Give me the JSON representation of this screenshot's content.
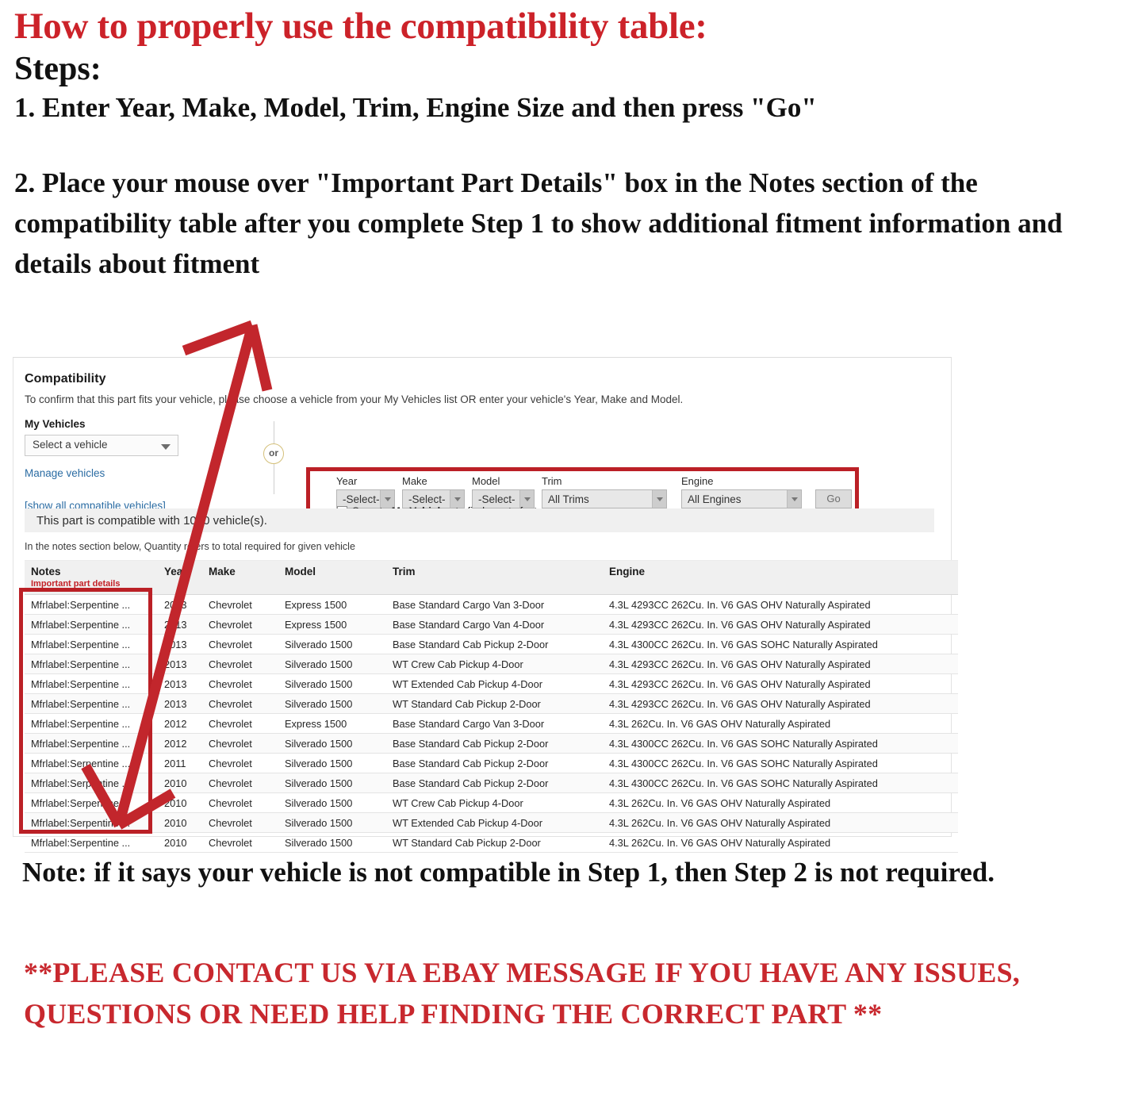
{
  "headline": {
    "title": "How to properly use the compatibility table:",
    "steps_label": "Steps:",
    "step1": "1. Enter Year, Make, Model, Trim, Engine Size and then press \"Go\"",
    "step2": "2. Place your mouse over \"Important Part Details\" box in the Notes section of the compatibility table after you complete Step 1 to show additional fitment information and details about fitment"
  },
  "panel": {
    "heading": "Compatibility",
    "subheading": "To confirm that this part fits your vehicle, please choose a vehicle from your My Vehicles list OR enter your vehicle's Year, Make and Model.",
    "my_vehicles_label": "My Vehicles",
    "vehicle_select_value": "Select a vehicle",
    "manage_vehicles_link": "Manage vehicles",
    "show_all_link": "[show all compatible vehicles]",
    "or_divider": "or",
    "selectors": [
      {
        "label": "Year",
        "value": "-Select-",
        "name": "year"
      },
      {
        "label": "Make",
        "value": "-Select-",
        "name": "make"
      },
      {
        "label": "Model",
        "value": "-Select-",
        "name": "model"
      },
      {
        "label": "Trim",
        "value": "All Trims",
        "name": "trim"
      },
      {
        "label": "Engine",
        "value": "All Engines",
        "name": "engine"
      }
    ],
    "go_button": "Go",
    "save_prefix": "Save to",
    "save_bold": "My Vehicles",
    "save_suffix": "to finds parts faster",
    "compat_count": "This part is compatible with 1000 vehicle(s).",
    "quantity_note": "In the notes section below, Quantity refers to total required for given vehicle"
  },
  "table": {
    "headers": {
      "notes": "Notes",
      "notes_sub": "Important part details",
      "year": "Year",
      "make": "Make",
      "model": "Model",
      "trim": "Trim",
      "engine": "Engine"
    },
    "rows": [
      {
        "notes": "Mfrlabel:Serpentine ...",
        "year": "2013",
        "make": "Chevrolet",
        "model": "Express 1500",
        "trim": "Base Standard Cargo Van 3-Door",
        "engine": "4.3L 4293CC 262Cu. In. V6 GAS OHV Naturally Aspirated"
      },
      {
        "notes": "Mfrlabel:Serpentine ...",
        "year": "2013",
        "make": "Chevrolet",
        "model": "Express 1500",
        "trim": "Base Standard Cargo Van 4-Door",
        "engine": "4.3L 4293CC 262Cu. In. V6 GAS OHV Naturally Aspirated"
      },
      {
        "notes": "Mfrlabel:Serpentine ...",
        "year": "2013",
        "make": "Chevrolet",
        "model": "Silverado 1500",
        "trim": "Base Standard Cab Pickup 2-Door",
        "engine": "4.3L 4300CC 262Cu. In. V6 GAS SOHC Naturally Aspirated"
      },
      {
        "notes": "Mfrlabel:Serpentine ...",
        "year": "2013",
        "make": "Chevrolet",
        "model": "Silverado 1500",
        "trim": "WT Crew Cab Pickup 4-Door",
        "engine": "4.3L 4293CC 262Cu. In. V6 GAS OHV Naturally Aspirated"
      },
      {
        "notes": "Mfrlabel:Serpentine ...",
        "year": "2013",
        "make": "Chevrolet",
        "model": "Silverado 1500",
        "trim": "WT Extended Cab Pickup 4-Door",
        "engine": "4.3L 4293CC 262Cu. In. V6 GAS OHV Naturally Aspirated"
      },
      {
        "notes": "Mfrlabel:Serpentine ...",
        "year": "2013",
        "make": "Chevrolet",
        "model": "Silverado 1500",
        "trim": "WT Standard Cab Pickup 2-Door",
        "engine": "4.3L 4293CC 262Cu. In. V6 GAS OHV Naturally Aspirated"
      },
      {
        "notes": "Mfrlabel:Serpentine ...",
        "year": "2012",
        "make": "Chevrolet",
        "model": "Express 1500",
        "trim": "Base Standard Cargo Van 3-Door",
        "engine": "4.3L 262Cu. In. V6 GAS OHV Naturally Aspirated"
      },
      {
        "notes": "Mfrlabel:Serpentine ...",
        "year": "2012",
        "make": "Chevrolet",
        "model": "Silverado 1500",
        "trim": "Base Standard Cab Pickup 2-Door",
        "engine": "4.3L 4300CC 262Cu. In. V6 GAS SOHC Naturally Aspirated"
      },
      {
        "notes": "Mfrlabel:Serpentine ...",
        "year": "2011",
        "make": "Chevrolet",
        "model": "Silverado 1500",
        "trim": "Base Standard Cab Pickup 2-Door",
        "engine": "4.3L 4300CC 262Cu. In. V6 GAS SOHC Naturally Aspirated"
      },
      {
        "notes": "Mfrlabel:Serpentine ...",
        "year": "2010",
        "make": "Chevrolet",
        "model": "Silverado 1500",
        "trim": "Base Standard Cab Pickup 2-Door",
        "engine": "4.3L 4300CC 262Cu. In. V6 GAS SOHC Naturally Aspirated"
      },
      {
        "notes": "Mfrlabel:Serpentine ...",
        "year": "2010",
        "make": "Chevrolet",
        "model": "Silverado 1500",
        "trim": "WT Crew Cab Pickup 4-Door",
        "engine": "4.3L 262Cu. In. V6 GAS OHV Naturally Aspirated"
      },
      {
        "notes": "Mfrlabel:Serpentine ...",
        "year": "2010",
        "make": "Chevrolet",
        "model": "Silverado 1500",
        "trim": "WT Extended Cab Pickup 4-Door",
        "engine": "4.3L 262Cu. In. V6 GAS OHV Naturally Aspirated"
      },
      {
        "notes": "Mfrlabel:Serpentine ...",
        "year": "2010",
        "make": "Chevrolet",
        "model": "Silverado 1500",
        "trim": "WT Standard Cab Pickup 2-Door",
        "engine": "4.3L 262Cu. In. V6 GAS OHV Naturally Aspirated"
      }
    ]
  },
  "footer": {
    "note": "Note: if it says your vehicle is not compatible in Step 1, then Step 2 is not required.",
    "contact": "**PLEASE CONTACT US VIA EBAY MESSAGE IF YOU HAVE ANY ISSUES, QUESTIONS OR NEED HELP FINDING THE CORRECT PART **"
  },
  "colors": {
    "accent_red": "#cc2229",
    "highlight_red": "#bb2026",
    "link_blue": "#2b6ca3",
    "panel_border": "#e2e2e2"
  }
}
